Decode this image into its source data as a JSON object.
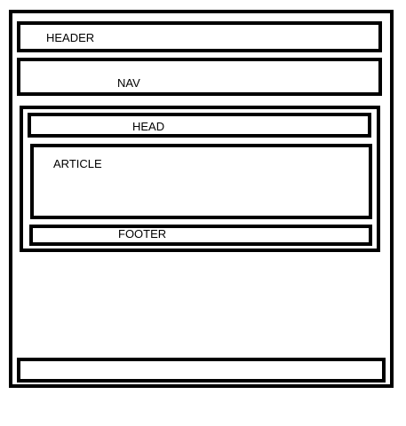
{
  "labels": {
    "header": "HEADER",
    "nav": "NAV",
    "head": "HEAD",
    "article": "ARTICLE",
    "footer": "FOOTER"
  }
}
